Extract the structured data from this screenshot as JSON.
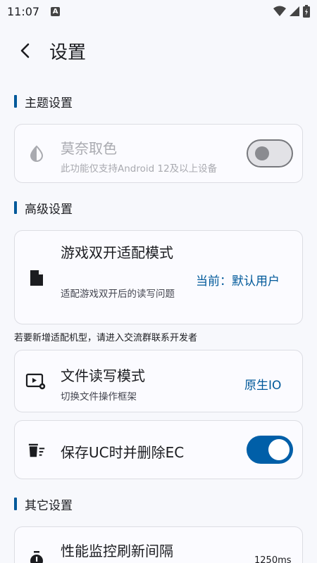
{
  "status_bar": {
    "time": "11:07",
    "a_badge": "A"
  },
  "header": {
    "title": "设置"
  },
  "sections": {
    "theme": {
      "title": "主题设置"
    },
    "advanced": {
      "title": "高级设置"
    },
    "other": {
      "title": "其它设置"
    }
  },
  "monet": {
    "title": "莫奈取色",
    "subtitle": "此功能仅支持Android 12及以上设备",
    "enabled": false
  },
  "dual_open": {
    "title": "游戏双开适配模式",
    "subtitle": "适配游戏双开后的读写问题",
    "value": "当前：默认用户"
  },
  "dual_hint": "若要新增适配机型，请进入交流群联系开发者",
  "file_rw": {
    "title": "文件读写模式",
    "subtitle": "切换文件操作框架",
    "value": "原生IO"
  },
  "save_uc": {
    "title": "保存UC时并删除EC",
    "enabled": true
  },
  "perf": {
    "title": "性能监控刷新间隔",
    "value": "1250ms"
  },
  "colors": {
    "accent": "#005fa8",
    "background": "#f7f8fc"
  },
  "icons": [
    "back-arrow-icon",
    "drop-icon",
    "file-icon",
    "video-settings-icon",
    "trash-list-icon",
    "stopwatch-icon"
  ]
}
